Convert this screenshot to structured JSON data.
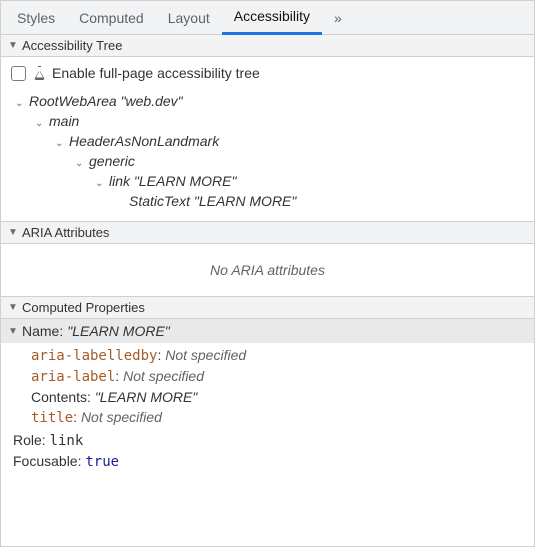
{
  "tabs": {
    "styles": "Styles",
    "computed": "Computed",
    "layout": "Layout",
    "accessibility": "Accessibility",
    "overflow": "»"
  },
  "sections": {
    "tree_header": "Accessibility Tree",
    "aria_header": "ARIA Attributes",
    "computed_header": "Computed Properties"
  },
  "tree_panel": {
    "enable_label": "Enable full-page accessibility tree",
    "rows": [
      {
        "depth": 0,
        "twisty": true,
        "text": "RootWebArea \"web.dev\""
      },
      {
        "depth": 1,
        "twisty": true,
        "text": "main"
      },
      {
        "depth": 2,
        "twisty": true,
        "text": "HeaderAsNonLandmark"
      },
      {
        "depth": 3,
        "twisty": true,
        "text": "generic"
      },
      {
        "depth": 4,
        "twisty": true,
        "text": "link \"LEARN MORE\""
      },
      {
        "depth": 5,
        "twisty": false,
        "text": "StaticText \"LEARN MORE\""
      }
    ]
  },
  "aria_panel": {
    "empty_text": "No ARIA attributes"
  },
  "computed_panel": {
    "name_label": "Name: ",
    "name_value": "\"LEARN MORE\"",
    "name_sources": [
      {
        "attr": "aria-labelledby",
        "value": "Not specified",
        "style": "notspec"
      },
      {
        "attr": "aria-label",
        "value": "Not specified",
        "style": "notspec"
      },
      {
        "attr_plain": "Contents",
        "value": "\"LEARN MORE\"",
        "style": "contents"
      },
      {
        "attr": "title",
        "value": "Not specified",
        "style": "notspec"
      }
    ],
    "role_label": "Role: ",
    "role_value": "link",
    "focusable_label": "Focusable: ",
    "focusable_value": "true"
  }
}
